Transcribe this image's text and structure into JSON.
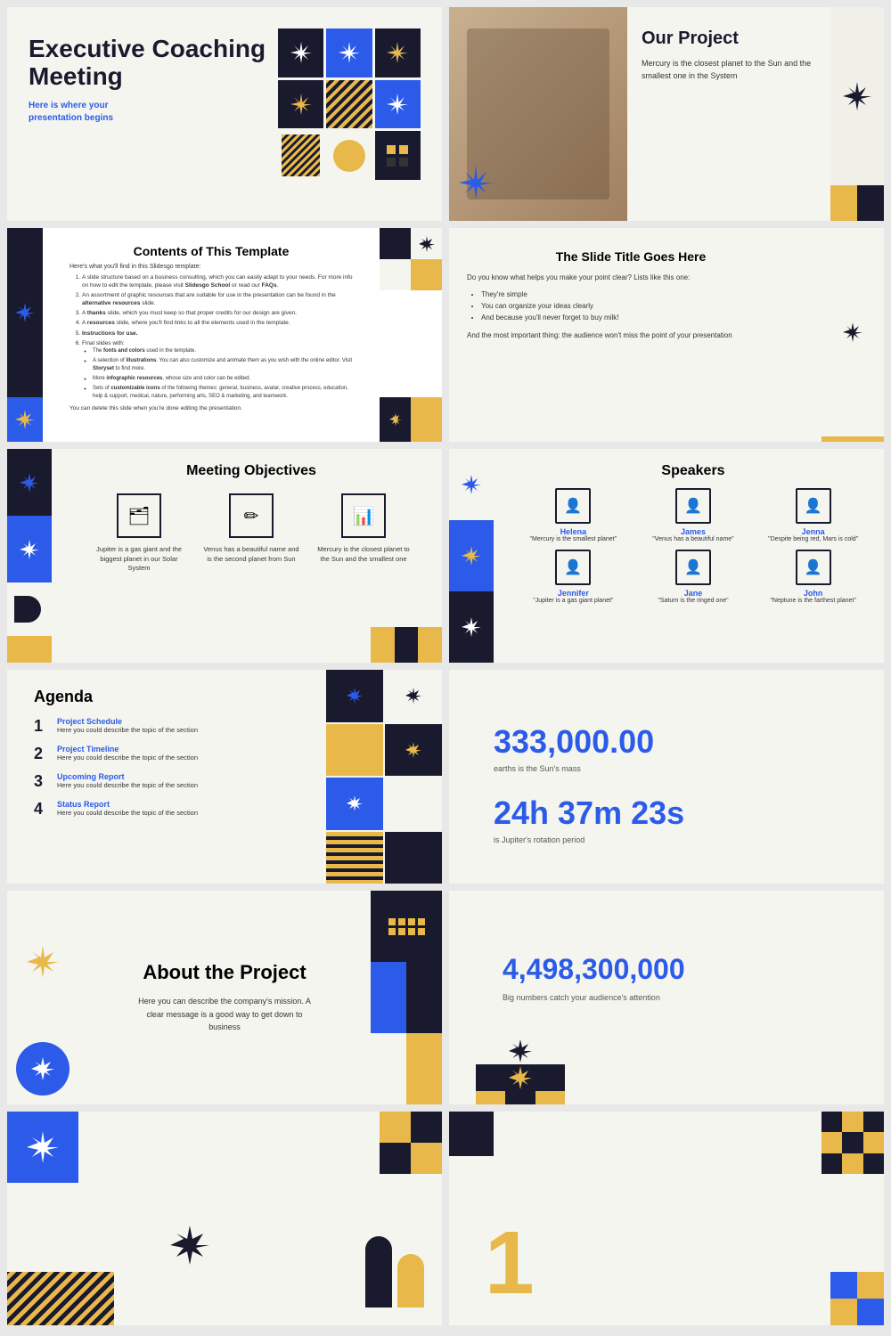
{
  "slides": [
    {
      "id": "slide-1",
      "title": "Executive Coaching Meeting",
      "subtitle": "Here is where your\npresentation begins"
    },
    {
      "id": "slide-2",
      "title": "Our Project",
      "description": "Mercury is the closest planet to the Sun and the smallest one in the System"
    },
    {
      "id": "slide-3",
      "title": "Contents of This Template",
      "intro": "Here's what you'll find in this Slidesgo template:",
      "items": [
        "A slide structure based on a business consulting, which you can easily adapt to your needs. For more info on how to edit the template, please visit Slidesgo School or read our FAQs.",
        "An assortment of graphic resources that are suitable for use in the presentation can be found in the alternative resources slide.",
        "A thanks slide, which you must keep so that proper credits for our design are given.",
        "A resources slide, where you'll find links to all the elements used in the template.",
        "Instructions for use.",
        "Final slides with: The fonts and colors used in the template. A selection of illustrations. You can also customize and animate them as you wish with the online editor. Visit Storyset to find more. More infographic resources, whose size and color can be edited. Sets of customizable icons."
      ],
      "footer": "You can delete this slide when you're done editing the presentation."
    },
    {
      "id": "slide-4",
      "title": "The Slide Title Goes Here",
      "intro": "Do you know what helps you make your point clear? Lists like this one:",
      "bullets": [
        "They're simple",
        "You can organize your ideas clearly",
        "And because you'll never forget to buy milk!"
      ],
      "conclusion": "And the most important thing: the audience won't miss the point of your presentation"
    },
    {
      "id": "slide-5",
      "title": "Meeting Objectives",
      "cards": [
        {
          "icon": "🗂",
          "text": "Jupiter is a gas giant and the biggest planet in our Solar System"
        },
        {
          "icon": "✏",
          "text": "Venus has a beautiful name and is the second planet from Sun"
        },
        {
          "icon": "📊",
          "text": "Mercury is the closest planet to the Sun and the smallest one"
        }
      ]
    },
    {
      "id": "slide-6",
      "title": "Speakers",
      "speakers": [
        {
          "name": "Helena",
          "quote": "\"Mercury is the smallest planet\""
        },
        {
          "name": "James",
          "quote": "\"Venus has a beautiful name\""
        },
        {
          "name": "Jenna",
          "quote": "\"Despite being red, Mars is cold\""
        },
        {
          "name": "Jennifer",
          "quote": "\"Jupiter is a gas giant planet\""
        },
        {
          "name": "Jane",
          "quote": "\"Saturn is the ringed one\""
        },
        {
          "name": "John",
          "quote": "\"Neptune is the farthest planet\""
        }
      ]
    },
    {
      "id": "slide-7",
      "title": "Agenda",
      "items": [
        {
          "num": "1",
          "title": "Project Schedule",
          "desc": "Here you could describe the topic of the section"
        },
        {
          "num": "2",
          "title": "Project Timeline",
          "desc": "Here you could describe the topic of the section"
        },
        {
          "num": "3",
          "title": "Upcoming Report",
          "desc": "Here you could describe the topic of the section"
        },
        {
          "num": "4",
          "title": "Status Report",
          "desc": "Here you could describe the topic of the section"
        }
      ]
    },
    {
      "id": "slide-8",
      "stat1": "333,000.00",
      "label1": "earths is the Sun's mass",
      "stat2": "24h 37m 23s",
      "label2": "is Jupiter's rotation period"
    },
    {
      "id": "slide-9",
      "title": "About the Project",
      "description": "Here you can describe the company's mission. A clear message is a good way to get down to business"
    },
    {
      "id": "slide-10",
      "stat": "4,498,300,000",
      "label": "Big numbers catch your audience's attention"
    },
    {
      "id": "slide-11",
      "label": ""
    },
    {
      "id": "slide-12",
      "num": "1"
    }
  ]
}
